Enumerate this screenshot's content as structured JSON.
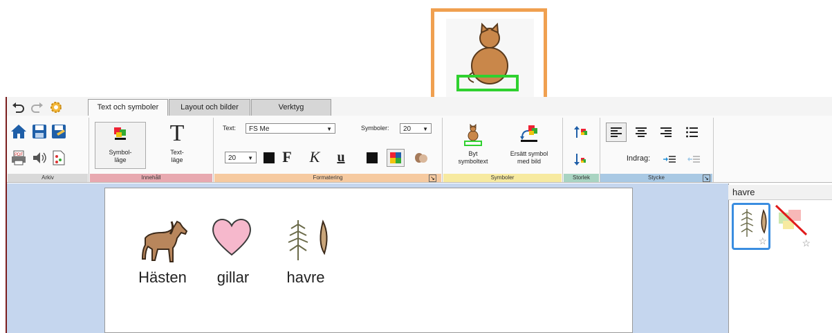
{
  "callout": {
    "icon": "cat-symbol-icon"
  },
  "quick_access": [
    "undo-icon",
    "redo-icon",
    "settings-icon"
  ],
  "tabs": [
    {
      "label": "Text och symboler",
      "active": true
    },
    {
      "label": "Layout och bilder",
      "active": false
    },
    {
      "label": "Verktyg",
      "active": false
    }
  ],
  "groups": {
    "arkiv": "Arkiv",
    "innehall": "Innehåll",
    "formatering": "Formatering",
    "symboler": "Symboler",
    "storlek": "Storlek",
    "stycke": "Stycke"
  },
  "group_colors": {
    "arkiv": "#d9d9d9",
    "innehall": "#e8a9b0",
    "formatering": "#f6caa0",
    "symboler": "#f7eaa0",
    "storlek": "#a9d4c2",
    "stycke": "#a9c9e4"
  },
  "innehall": {
    "symbol_mode_line1": "Symbol-",
    "symbol_mode_line2": "läge",
    "text_mode_line1": "Text-",
    "text_mode_line2": "läge",
    "text_icon": "T"
  },
  "formatering": {
    "text_label": "Text:",
    "font_value": "FS Me",
    "symbols_label": "Symboler:",
    "symbols_value": "20",
    "size_value": "20",
    "bold": "F",
    "italic": "K",
    "underline": "u"
  },
  "symboler": {
    "byt_line1": "Byt",
    "byt_line2": "symboltext",
    "ersatt_line1": "Ersätt symbol",
    "ersatt_line2": "med bild"
  },
  "stycke": {
    "indent_label": "Indrag:"
  },
  "document": {
    "words": [
      "Hästen",
      "gillar",
      "havre"
    ]
  },
  "panel": {
    "title": "havre"
  }
}
